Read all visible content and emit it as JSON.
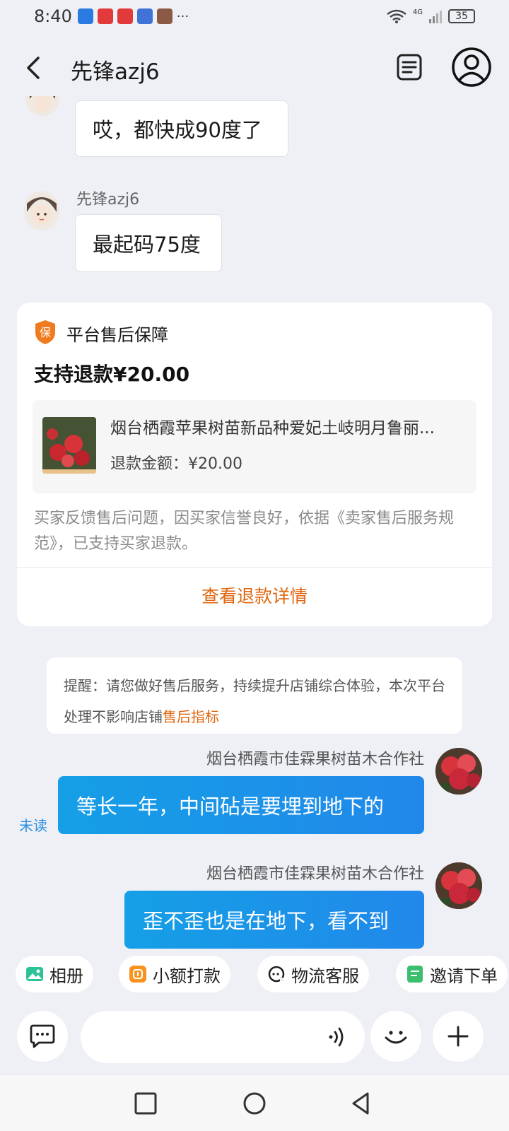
{
  "status": {
    "time": "8:40",
    "more": "···",
    "network": "4G",
    "battery": "35"
  },
  "header": {
    "title": "先锋azj6"
  },
  "messages": {
    "buyer_msg1": "哎，都快成90度了",
    "buyer_name": "先锋azj6",
    "buyer_msg2": "最起码75度"
  },
  "card": {
    "badge_icon_text": "保",
    "badge_title": "平台售后保障",
    "refund_title": "支持退款¥20.00",
    "product_name": "烟台栖霞苹果树苗新品种爱妃土岐明月鲁丽...",
    "refund_amount": "退款金额：¥20.00",
    "description": "买家反馈售后问题，因买家信誉良好，依据《卖家售后服务规范》，已支持买家退款。",
    "view_details": "查看退款详情"
  },
  "reminder": {
    "text": "提醒：请您做好售后服务，持续提升店铺综合体验，本次平台处理不影响店铺",
    "highlight": "售后指标"
  },
  "seller": {
    "name": "烟台栖霞市佳霖果树苗木合作社",
    "msg1": "等长一年，中间砧是要埋到地下的",
    "unread": "未读",
    "msg2": "歪不歪也是在地下，看不到"
  },
  "quick_actions": {
    "album": "相册",
    "small_payment": "小额打款",
    "logistics": "物流客服",
    "invite_order": "邀请下单"
  },
  "colors": {
    "accent_orange": "#e0660f",
    "bubble_blue": "#1d93e8",
    "unread_blue": "#2d8fe0"
  }
}
